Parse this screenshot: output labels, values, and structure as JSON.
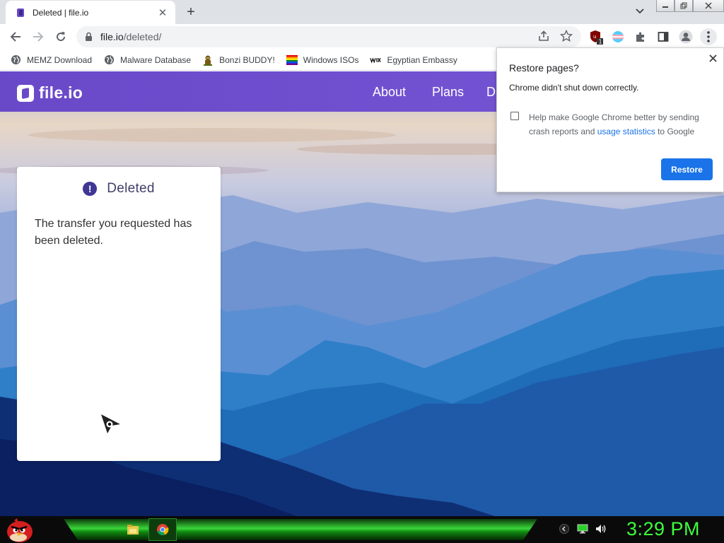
{
  "browser": {
    "tab": {
      "title": "Deleted | file.io",
      "close_icon": "✕"
    },
    "new_tab_icon": "+",
    "address": {
      "host": "file.io",
      "path": "/deleted/"
    },
    "extension_badge": "1",
    "bookmarks": [
      {
        "label": "MEMZ Download",
        "icon": "globe-icon"
      },
      {
        "label": "Malware Database",
        "icon": "globe-icon"
      },
      {
        "label": "Bonzi BUDDY!",
        "icon": "bonzi-icon"
      },
      {
        "label": "Windows ISOs",
        "icon": "rainbow-flag-icon"
      },
      {
        "label": "Egyptian Embassy",
        "icon": "wix-icon"
      }
    ]
  },
  "site": {
    "logo": "file.io",
    "nav": [
      "About",
      "Plans",
      "D"
    ],
    "card": {
      "title": "Deleted",
      "message": "The transfer you requested has been deleted."
    }
  },
  "restore_popup": {
    "title": "Restore pages?",
    "description": "Chrome didn't shut down correctly.",
    "checkbox_text_before": "Help make Google Chrome better by sending crash reports and ",
    "checkbox_link": "usage statistics",
    "checkbox_text_after": " to Google",
    "button": "Restore",
    "checked": false
  },
  "taskbar": {
    "clock": "3:29 PM"
  },
  "colors": {
    "site_nav": "#6a49c9",
    "restore_button": "#1a73e8",
    "clock": "#3cff3c"
  }
}
